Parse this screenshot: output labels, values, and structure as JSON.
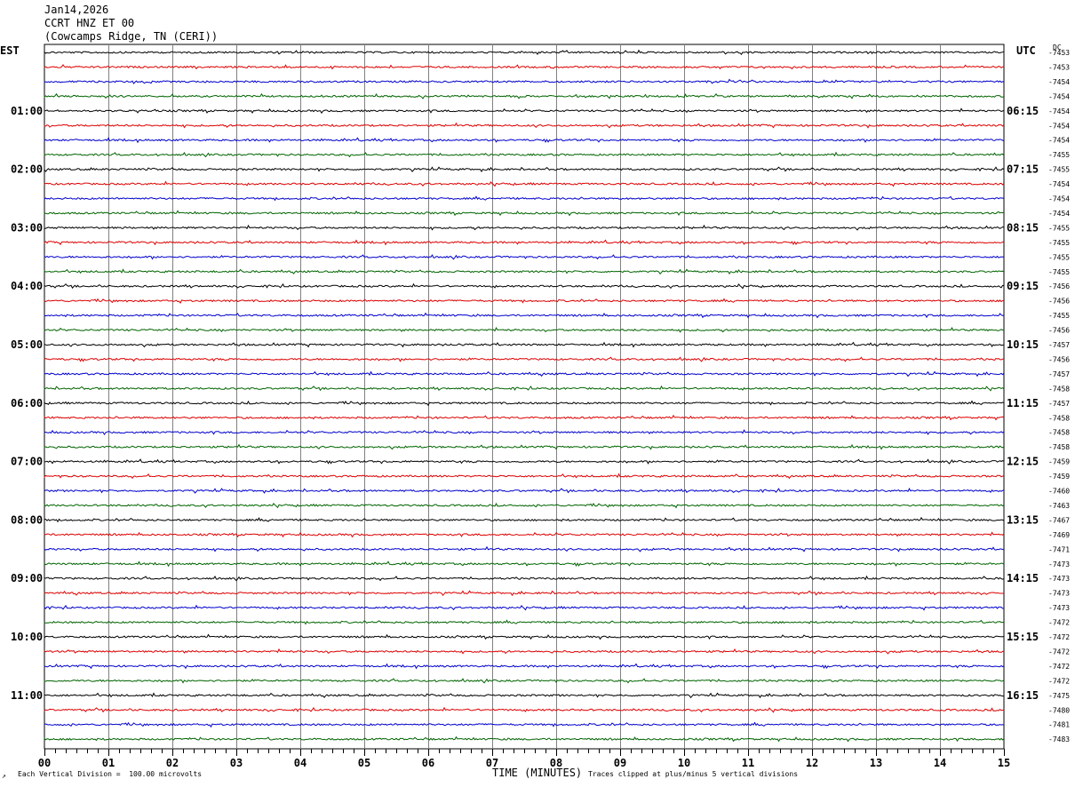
{
  "header": {
    "date": "Jan14,2026",
    "station": "CCRT HNZ ET 00",
    "location": "(Cowcamps Ridge, TN (CERI))"
  },
  "corner_labels": {
    "left": "EST",
    "right": "UTC",
    "dc": "DC"
  },
  "footer": {
    "mark": "↗",
    "division_note": "Each Vertical Division =  100.00 microvolts",
    "clip_note": "Traces clipped at plus/minus 5 vertical divisions",
    "time_label": "TIME (MINUTES)"
  },
  "colors": {
    "trace_cycle": [
      "#000000",
      "#dd0000",
      "#0000cc",
      "#006400"
    ],
    "grid": "#808080"
  },
  "chart_data": {
    "type": "line",
    "title": "CCRT HNZ ET 00",
    "xlabel": "TIME (MINUTES)",
    "xlim": [
      0,
      15
    ],
    "x_ticks": [
      "00",
      "01",
      "02",
      "03",
      "04",
      "05",
      "06",
      "07",
      "08",
      "09",
      "10",
      "11",
      "12",
      "13",
      "14",
      "15"
    ],
    "minutes_per_line": 15,
    "left_time_labels": [
      "01:00",
      "02:00",
      "03:00",
      "04:00",
      "05:00",
      "06:00",
      "07:00",
      "08:00",
      "09:00",
      "10:00",
      "11:00"
    ],
    "right_time_labels": [
      "06:15",
      "07:15",
      "08:15",
      "09:15",
      "10:15",
      "11:15",
      "12:15",
      "13:15",
      "14:15",
      "15:15",
      "16:15"
    ],
    "dc_offsets": [
      "-7453",
      "-7453",
      "-7454",
      "-7454",
      "-7454",
      "-7454",
      "-7454",
      "-7455",
      "-7455",
      "-7454",
      "-7454",
      "-7454",
      "-7455",
      "-7455",
      "-7455",
      "-7455",
      "-7456",
      "-7456",
      "-7455",
      "-7456",
      "-7457",
      "-7456",
      "-7457",
      "-7458",
      "-7457",
      "-7458",
      "-7458",
      "-7458",
      "-7459",
      "-7459",
      "-7460",
      "-7463",
      "-7467",
      "-7469",
      "-7471",
      "-7473",
      "-7473",
      "-7473",
      "-7473",
      "-7472",
      "-7472",
      "-7472",
      "-7472",
      "-7472",
      "-7475",
      "-7480",
      "-7481",
      "-7483"
    ],
    "trace_count": 48
  }
}
